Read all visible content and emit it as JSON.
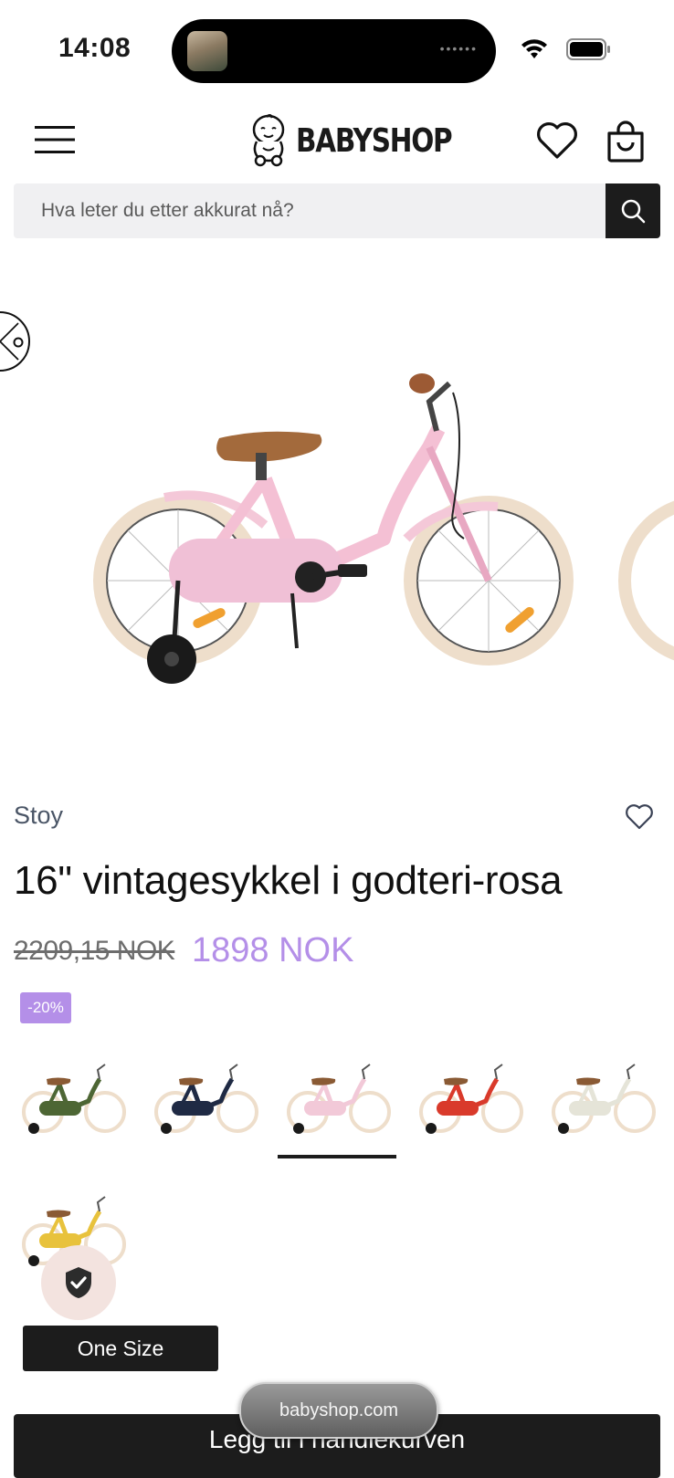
{
  "status_bar": {
    "time": "14:08"
  },
  "header": {
    "brand_logo": "BABYSHOP",
    "icons": [
      "menu-icon",
      "heart-icon",
      "shopping-bag-icon"
    ]
  },
  "search": {
    "placeholder": "Hva leter du etter akkurat nå?"
  },
  "product": {
    "brand": "Stoy",
    "title": "16\" vintagesykkel i godteri-rosa",
    "old_price": "2209,15 NOK",
    "price": "1898 NOK",
    "discount": "-20%",
    "variant_colors": [
      "#4d6634",
      "#1f2a44",
      "#f2c9d8",
      "#d93a2b",
      "#e5e4d8",
      "#e8c23c"
    ],
    "selected_variant_index": 2,
    "size_label": "One Size",
    "add_to_cart_label": "Legg til i handlekurven"
  },
  "colors": {
    "accent_purple": "#b48fe8",
    "dark": "#1c1c1c",
    "search_bg": "#f0f0f2"
  },
  "browser": {
    "url": "babyshop.com"
  }
}
